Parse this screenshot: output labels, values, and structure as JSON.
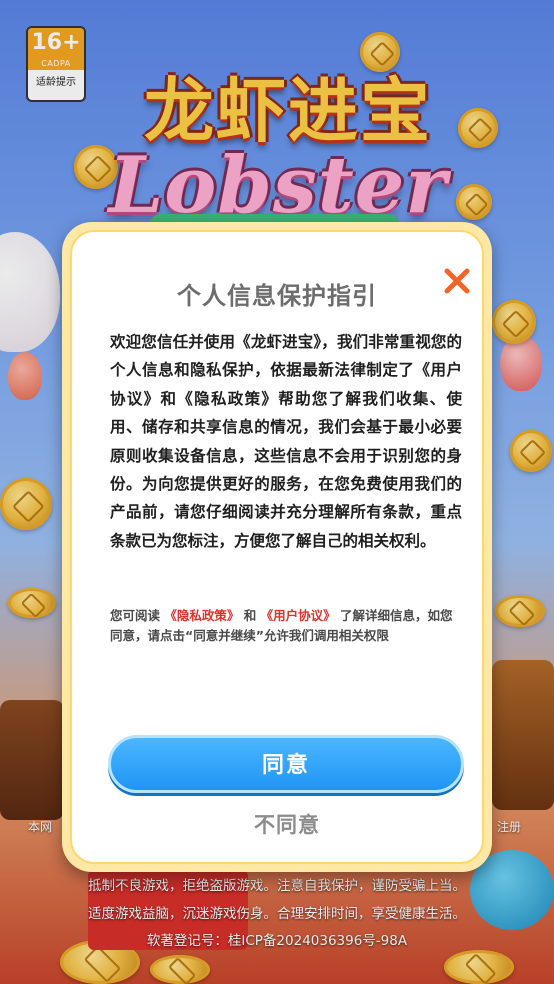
{
  "age_badge": {
    "rating": "16+",
    "org": "CADPA",
    "caption": "适龄提示"
  },
  "logo": {
    "chinese": "龙虾进宝",
    "english": "Lobster"
  },
  "background": {
    "left_text": "本网",
    "right_text": "注册",
    "footer_lines": [
      "抵制不良游戏，拒绝盗版游戏。注意自我保护，谨防受骗上当。",
      "适度游戏益脑，沉迷游戏伤身。合理安排时间，享受健康生活。",
      "软著登记号：桂ICP备2024036396号-98A"
    ]
  },
  "dialog": {
    "title": "个人信息保护指引",
    "close_icon": "close-icon",
    "body": "欢迎您信任并使用《龙虾进宝》，我们非常重视您的个人信息和隐私保护，依据最新法律制定了《用户协议》和《隐私政策》帮助您了解我们收集、使用、储存和共享信息的情况，我们会基于最小必要原则收集设备信息，这些信息不会用于识别您的身份。为向您提供更好的服务，在您免费使用我们的产品前，请您仔细阅读并充分理解所有条款，重点条款已为您标注，方便您了解自己的相关权利。",
    "notice_prefix": "您可阅读",
    "privacy_link": "《隐私政策》",
    "notice_and": "和",
    "agreement_link": "《用户协议》",
    "notice_suffix": "了解详细信息，如您同意，请点击“同意并继续”允许我们调用相关权限",
    "agree_label": "同意",
    "disagree_label": "不同意"
  },
  "colors": {
    "accent": "#1f95f4",
    "link": "#e0312b",
    "close": "#f4652a",
    "frame": "#ffe7a6"
  }
}
